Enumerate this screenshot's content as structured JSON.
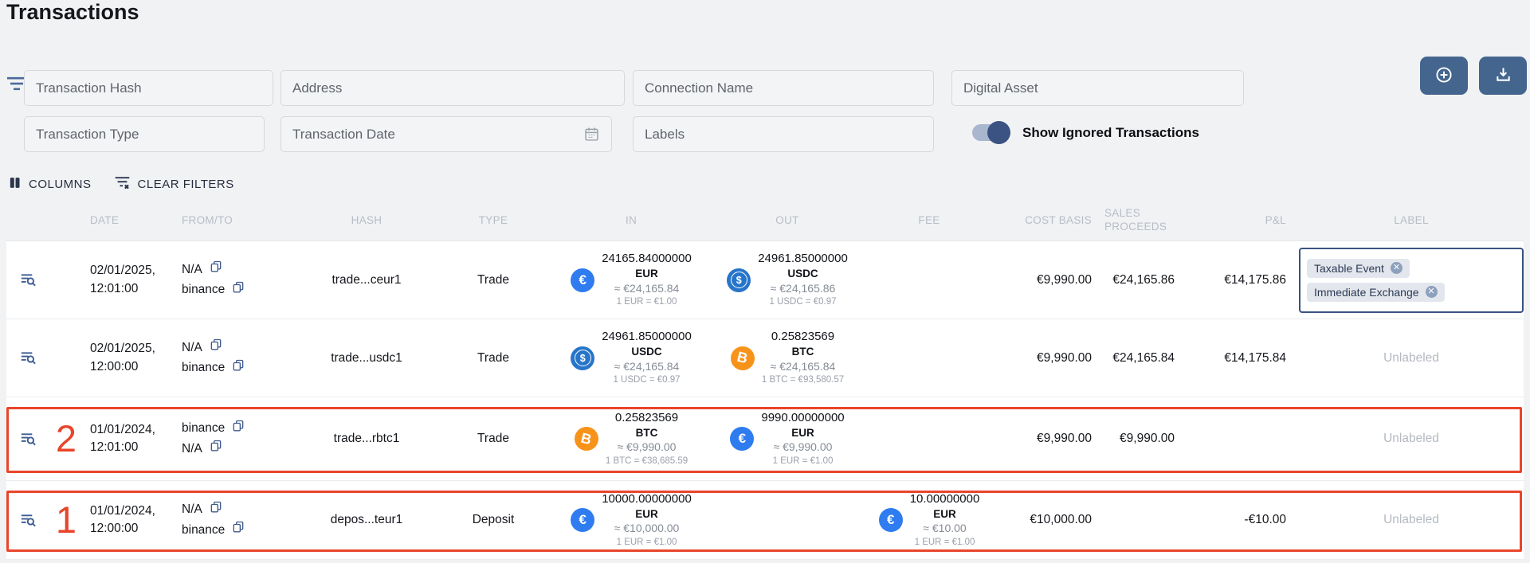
{
  "page": {
    "title": "Transactions"
  },
  "colors": {
    "accent_navy": "#3a5382",
    "highlight_red": "#e8452b",
    "button_blue": "#44658e",
    "eur_blue": "#2e7cf0",
    "usdc_blue": "#2775ca",
    "btc_orange": "#f7931a"
  },
  "filters": {
    "transaction_hash": "Transaction Hash",
    "address": "Address",
    "connection_name": "Connection Name",
    "digital_asset": "Digital Asset",
    "transaction_type": "Transaction Type",
    "transaction_date": "Transaction Date",
    "labels": "Labels",
    "show_ignored_label": "Show Ignored Transactions",
    "show_ignored_on": true
  },
  "toolbar": {
    "columns_label": "COLUMNS",
    "clear_filters_label": "CLEAR FILTERS"
  },
  "table": {
    "headers": [
      "DATE",
      "FROM/TO",
      "HASH",
      "TYPE",
      "IN",
      "OUT",
      "FEE",
      "COST BASIS",
      "SALES PROCEEDS",
      "P&L",
      "LABEL"
    ],
    "rows": [
      {
        "number": "",
        "date": "02/01/2025,",
        "time": "12:01:00",
        "from": "N/A",
        "to": "binance",
        "hash": "trade...ceur1",
        "type": "Trade",
        "in": {
          "amount": "24165.84000000",
          "code": "EUR",
          "approx": "≈ €24,165.84",
          "rate": "1 EUR = €1.00"
        },
        "out": {
          "amount": "24961.85000000",
          "code": "USDC",
          "approx": "≈ €24,165.86",
          "rate": "1 USDC = €0.97"
        },
        "cost_basis": "€9,990.00",
        "sales_proceeds": "€24,165.86",
        "pnl": "€14,175.86",
        "chips": [
          "Taxable Event",
          "Immediate Exchange"
        ],
        "label": ""
      },
      {
        "number": "",
        "date": "02/01/2025,",
        "time": "12:00:00",
        "from": "N/A",
        "to": "binance",
        "hash": "trade...usdc1",
        "type": "Trade",
        "in": {
          "amount": "24961.85000000",
          "code": "USDC",
          "approx": "≈ €24,165.84",
          "rate": "1 USDC = €0.97"
        },
        "out": {
          "amount": "0.25823569",
          "code": "BTC",
          "approx": "≈ €24,165.84",
          "rate": "1 BTC = €93,580.57"
        },
        "cost_basis": "€9,990.00",
        "sales_proceeds": "€24,165.84",
        "pnl": "€14,175.84",
        "label": "Unlabeled"
      },
      {
        "number": "2",
        "date": "01/01/2024,",
        "time": "12:01:00",
        "from": "binance",
        "to": "N/A",
        "hash": "trade...rbtc1",
        "type": "Trade",
        "in": {
          "amount": "0.25823569",
          "code": "BTC",
          "approx": "≈ €9,990.00",
          "rate": "1 BTC = €38,685.59"
        },
        "out": {
          "amount": "9990.00000000",
          "code": "EUR",
          "approx": "≈ €9,990.00",
          "rate": "1 EUR = €1.00"
        },
        "cost_basis": "€9,990.00",
        "sales_proceeds": "€9,990.00",
        "pnl": "",
        "label": "Unlabeled"
      },
      {
        "number": "1",
        "date": "01/01/2024,",
        "time": "12:00:00",
        "from": "N/A",
        "to": "binance",
        "hash": "depos...teur1",
        "type": "Deposit",
        "in": {
          "amount": "10000.00000000",
          "code": "EUR",
          "approx": "≈ €10,000.00",
          "rate": "1 EUR = €1.00"
        },
        "fee": {
          "amount": "10.00000000",
          "code": "EUR",
          "approx": "≈ €10.00",
          "rate": "1 EUR = €1.00"
        },
        "cost_basis": "€10,000.00",
        "sales_proceeds": "",
        "pnl": "-€10.00",
        "label": "Unlabeled"
      }
    ]
  }
}
